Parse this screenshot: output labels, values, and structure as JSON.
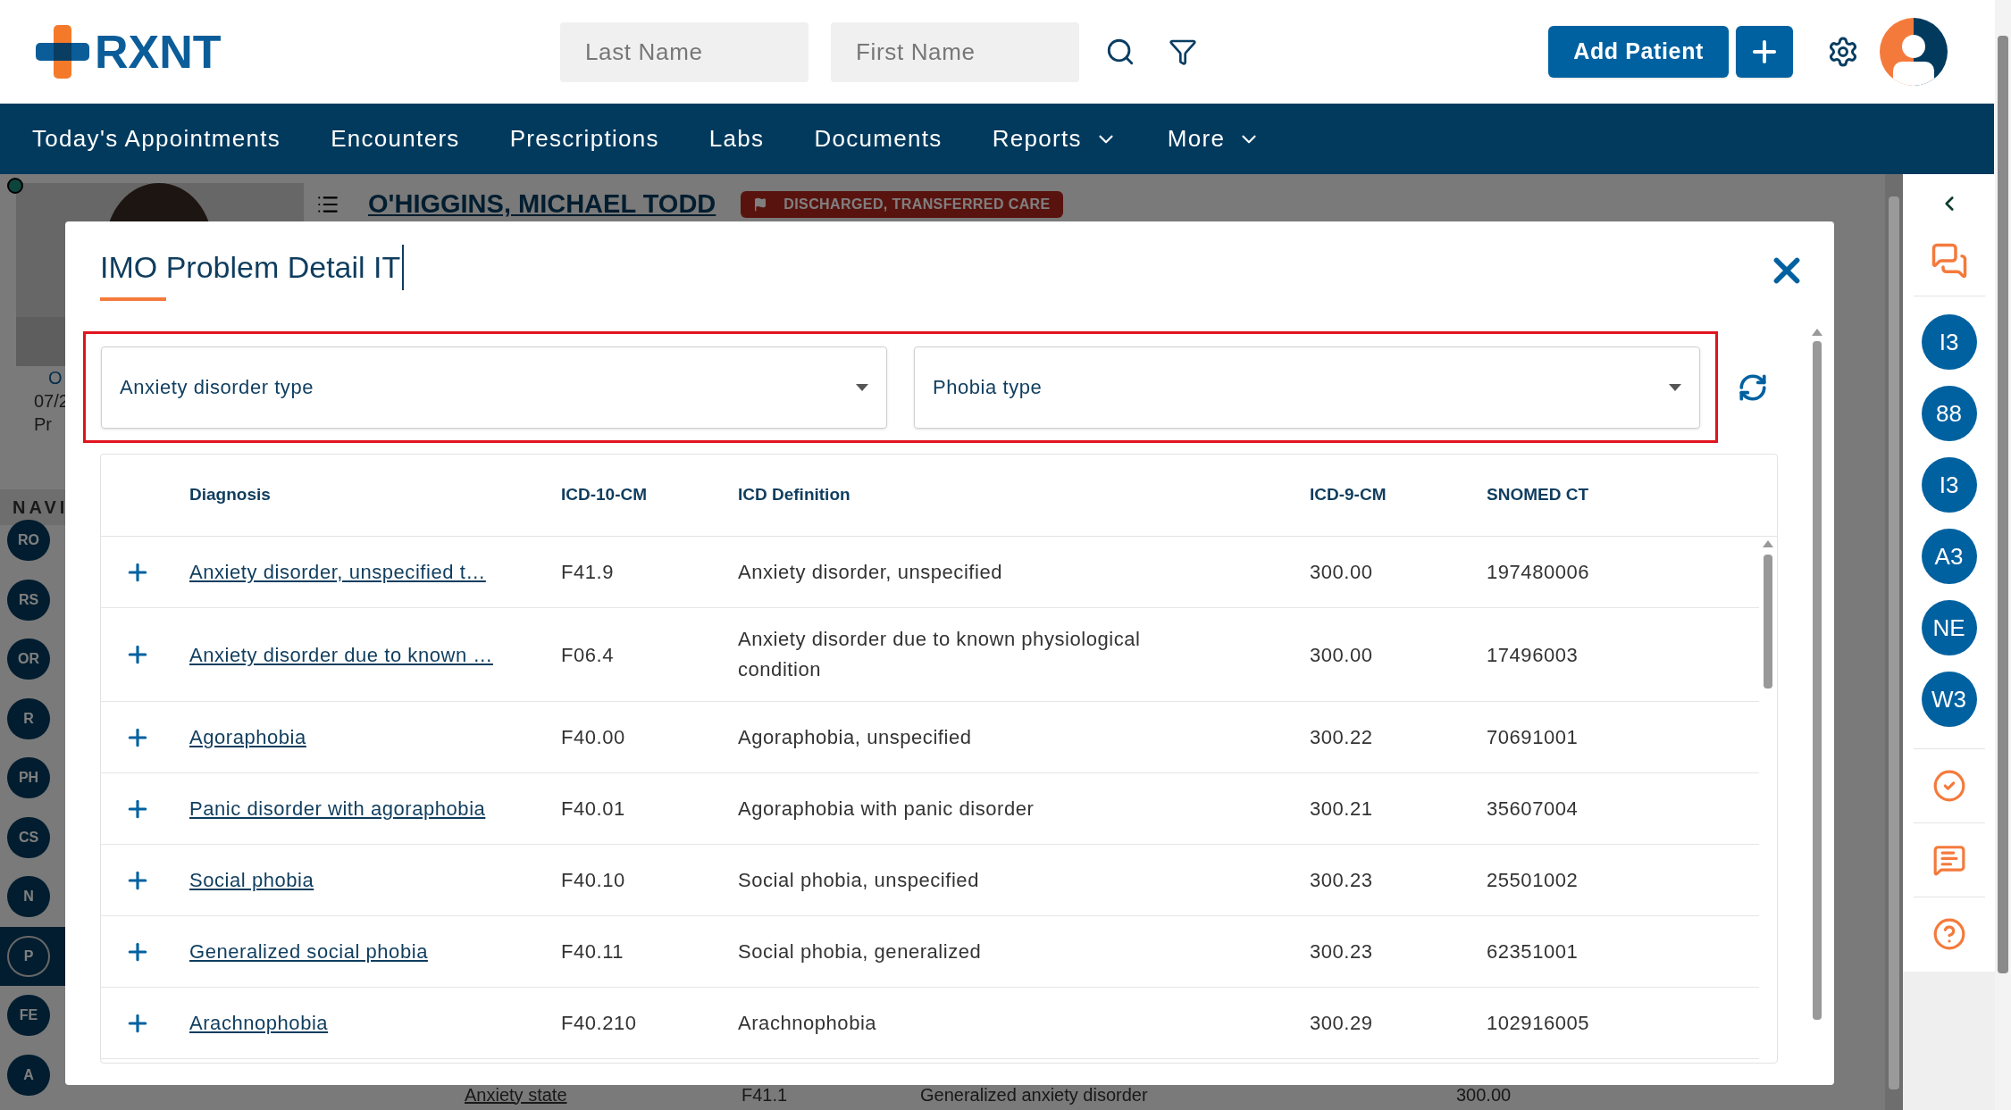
{
  "header": {
    "logo": "RXNT",
    "search_fields": [
      {
        "placeholder": "Last Name"
      },
      {
        "placeholder": "First Name"
      }
    ],
    "add_button": "Add Patient"
  },
  "nav": [
    {
      "label": "Today's Appointments",
      "has_menu": false
    },
    {
      "label": "Encounters",
      "has_menu": false
    },
    {
      "label": "Prescriptions",
      "has_menu": false
    },
    {
      "label": "Labs",
      "has_menu": false
    },
    {
      "label": "Documents",
      "has_menu": false
    },
    {
      "label": "Reports",
      "has_menu": true
    },
    {
      "label": "More",
      "has_menu": true
    }
  ],
  "patient": {
    "name": "O'HIGGINS, MICHAEL TODD",
    "status": "DISCHARGED, TRANSFERRED CARE",
    "info_lines": [
      "O",
      "07/2",
      "Pr"
    ]
  },
  "side_nav": {
    "label": "NAVI",
    "items": [
      {
        "label": "RO",
        "selected": false
      },
      {
        "label": "RS",
        "selected": false
      },
      {
        "label": "OR",
        "selected": false
      },
      {
        "label": "R",
        "selected": false
      },
      {
        "label": "PH",
        "selected": false
      },
      {
        "label": "CS",
        "selected": false
      },
      {
        "label": "N",
        "selected": false
      },
      {
        "label": "P",
        "selected": true
      },
      {
        "label": "FE",
        "selected": false
      },
      {
        "label": "A",
        "selected": false
      }
    ]
  },
  "background_row": [
    "Anxiety state",
    "F41.1",
    "Generalized anxiety disorder",
    "300.00"
  ],
  "right_rail": {
    "badges": [
      "I3",
      "88",
      "I3",
      "A3",
      "NE",
      "W3"
    ]
  },
  "modal": {
    "title": "IMO Problem Detail IT",
    "filters": [
      {
        "value": "Anxiety disorder type"
      },
      {
        "value": "Phobia type"
      }
    ],
    "columns": [
      "Diagnosis",
      "ICD-10-CM",
      "ICD Definition",
      "ICD-9-CM",
      "SNOMED CT"
    ],
    "rows": [
      {
        "diagnosis": "Anxiety disorder, unspecified t…",
        "icd10": "F41.9",
        "definition": "Anxiety disorder, unspecified",
        "icd9": "300.00",
        "snomed": "197480006"
      },
      {
        "diagnosis": "Anxiety disorder due to known …",
        "icd10": "F06.4",
        "definition": "Anxiety disorder due to known physiological condition",
        "icd9": "300.00",
        "snomed": "17496003"
      },
      {
        "diagnosis": "Agoraphobia",
        "icd10": "F40.00",
        "definition": "Agoraphobia, unspecified",
        "icd9": "300.22",
        "snomed": "70691001"
      },
      {
        "diagnosis": "Panic disorder with agoraphobia",
        "icd10": "F40.01",
        "definition": "Agoraphobia with panic disorder",
        "icd9": "300.21",
        "snomed": "35607004"
      },
      {
        "diagnosis": "Social phobia",
        "icd10": "F40.10",
        "definition": "Social phobia, unspecified",
        "icd9": "300.23",
        "snomed": "25501002"
      },
      {
        "diagnosis": "Generalized social phobia",
        "icd10": "F40.11",
        "definition": "Social phobia, generalized",
        "icd9": "300.23",
        "snomed": "62351001"
      },
      {
        "diagnosis": "Arachnophobia",
        "icd10": "F40.210",
        "definition": "Arachnophobia",
        "icd9": "300.29",
        "snomed": "102916005"
      }
    ]
  }
}
